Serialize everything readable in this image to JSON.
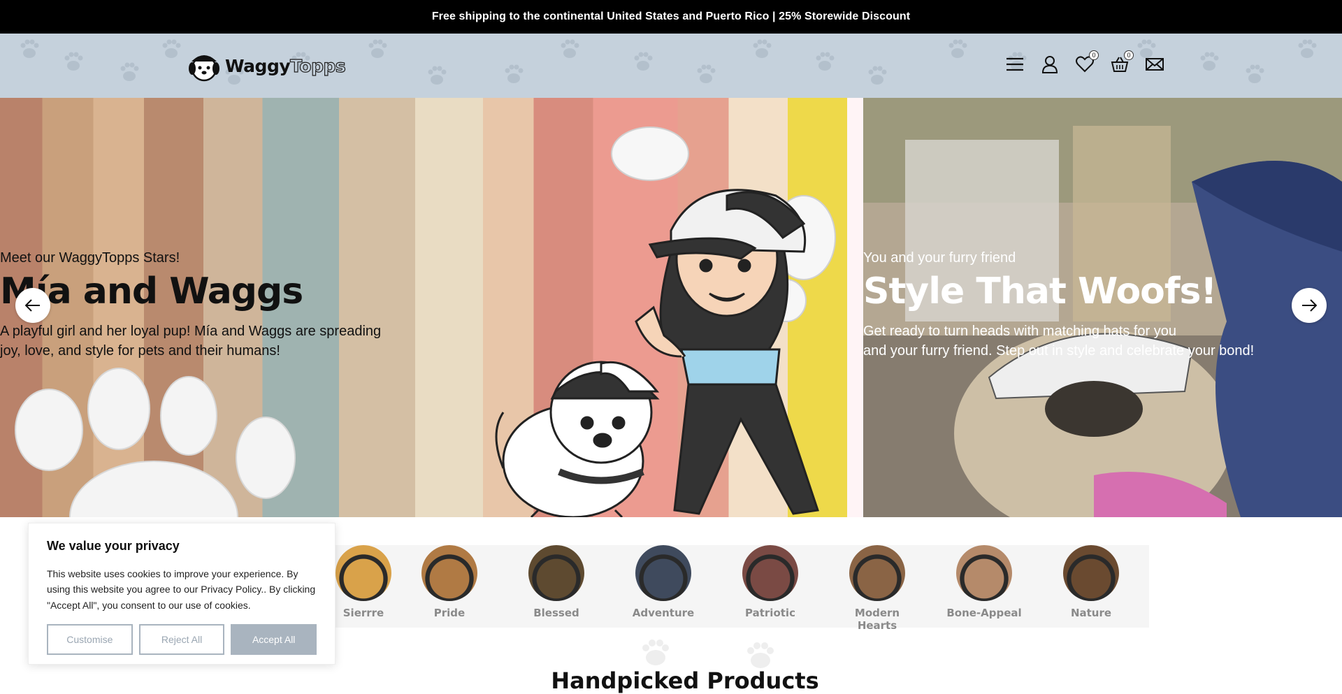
{
  "announcement": "Free shipping to the continental United States and Puerto Rico | 25% Storewide Discount",
  "logo": {
    "part1": "Waggy",
    "part2": "Topps"
  },
  "nav": {
    "icons": [
      "menu-icon",
      "account-icon",
      "wishlist-icon",
      "cart-icon",
      "mail-icon"
    ],
    "wishlist_count": "0",
    "cart_count": "0"
  },
  "hero": {
    "slide1": {
      "kicker": "Meet our WaggyTopps Stars!",
      "headline": "Mía and Waggs",
      "desc_line1": "A playful girl and her loyal pup! Mía and Waggs are spreading",
      "desc_line2": "joy, love, and style for pets and their humans!"
    },
    "slide2": {
      "kicker": "You and your furry friend",
      "headline": "Style That Woofs!",
      "desc_line1": "Get ready to turn heads with matching hats for you",
      "desc_line2": "and your furry friend. Step out in style and celebrate your bond!"
    }
  },
  "categories": [
    {
      "label": "Sierrre",
      "color": "#d9a24a"
    },
    {
      "label": "Pride",
      "color": "#b07a44"
    },
    {
      "label": "Blessed",
      "color": "#5e4a30"
    },
    {
      "label": "Adventure",
      "color": "#3f4a5d"
    },
    {
      "label": "Patriotic",
      "color": "#7a4a44"
    },
    {
      "label": "Modern Hearts",
      "color": "#8a6445"
    },
    {
      "label": "Bone-Appeal",
      "color": "#b58a6a"
    },
    {
      "label": "Nature",
      "color": "#6a4a30"
    }
  ],
  "section_title": "Handpicked Products",
  "cookie": {
    "title": "We value your privacy",
    "body": "This website uses cookies to improve your experience. By using this website you agree to our Privacy Policy.. By clicking \"Accept All\", you consent to our use of cookies.",
    "customise": "Customise",
    "reject": "Reject All",
    "accept": "Accept All"
  }
}
